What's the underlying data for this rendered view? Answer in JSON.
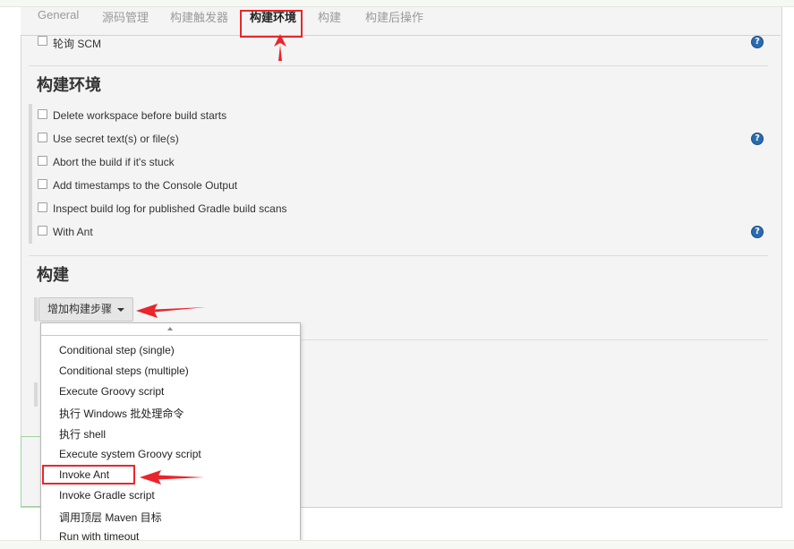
{
  "tabs": [
    {
      "label": "General"
    },
    {
      "label": "源码管理"
    },
    {
      "label": "构建触发器"
    },
    {
      "label": "构建环境"
    },
    {
      "label": "构建"
    },
    {
      "label": "构建后操作"
    }
  ],
  "active_tab": "构建环境",
  "poll_scm": {
    "label": "轮询 SCM"
  },
  "build_env": {
    "title": "构建环境",
    "options": [
      {
        "label": "Delete workspace before build starts"
      },
      {
        "label": "Use secret text(s) or file(s)"
      },
      {
        "label": "Abort the build if it's stuck"
      },
      {
        "label": "Add timestamps to the Console Output"
      },
      {
        "label": "Inspect build log for published Gradle build scans"
      },
      {
        "label": "With Ant"
      }
    ]
  },
  "build": {
    "title": "构建",
    "add_step_label": "增加构建步骤"
  },
  "dropdown": {
    "items": [
      {
        "label": "Conditional step (single)"
      },
      {
        "label": "Conditional steps (multiple)"
      },
      {
        "label": "Execute Groovy script"
      },
      {
        "label": "执行 Windows 批处理命令"
      },
      {
        "label": "执行 shell"
      },
      {
        "label": "Execute system Groovy script"
      },
      {
        "label": "Invoke Ant"
      },
      {
        "label": "Invoke Gradle script"
      },
      {
        "label": "调用顶层 Maven 目标"
      },
      {
        "label": "Run with timeout"
      }
    ]
  },
  "help_icon_glyph": "?",
  "colors": {
    "annotation_red": "#e8262b",
    "help_blue": "#2a6bb0",
    "panel_bg": "#f4f4f4"
  }
}
